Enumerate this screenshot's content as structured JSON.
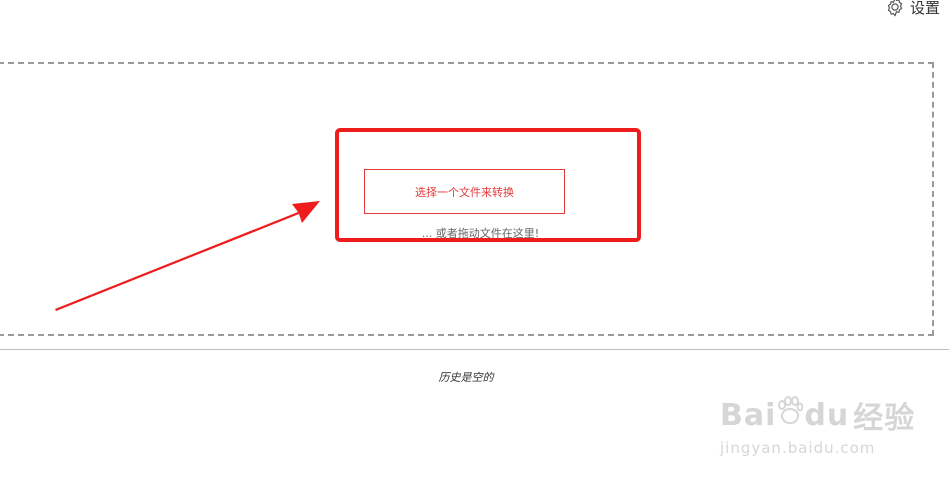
{
  "header": {
    "settings_label": "设置",
    "settings_icon": "gear-icon"
  },
  "upload": {
    "choose_button_label": "选择一个文件来转换",
    "drop_hint": "... 或者拖动文件在这里!"
  },
  "history": {
    "empty_text": "历史是空的"
  },
  "annotation": {
    "highlight_color": "#ee1c1c",
    "arrow_color": "#ee1c1c"
  },
  "watermark": {
    "logo_text_left": "Bai",
    "logo_text_right": "du",
    "logo_cn": "经验",
    "url": "jingyan.baidu.com"
  }
}
